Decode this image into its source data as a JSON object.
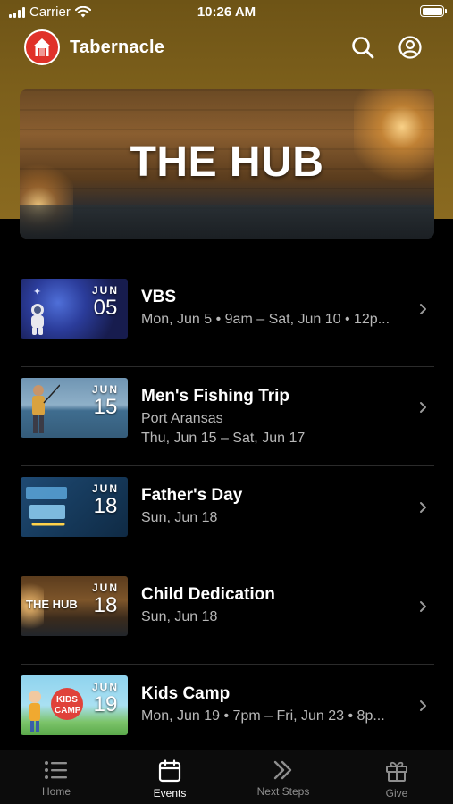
{
  "status_bar": {
    "carrier": "Carrier",
    "time": "10:26 AM"
  },
  "app": {
    "title": "Tabernacle"
  },
  "hero": {
    "title": "THE HUB"
  },
  "events": [
    {
      "title": "VBS",
      "lines": [
        "Mon, Jun 5 • 9am – Sat, Jun 10 • 12p..."
      ],
      "month": "JUN",
      "day": "05"
    },
    {
      "title": "Men's Fishing Trip",
      "lines": [
        "Port Aransas",
        "Thu, Jun 15 – Sat, Jun 17"
      ],
      "month": "JUN",
      "day": "15"
    },
    {
      "title": "Father's Day",
      "lines": [
        "Sun, Jun 18"
      ],
      "month": "JUN",
      "day": "18"
    },
    {
      "title": "Child Dedication",
      "lines": [
        "Sun, Jun 18"
      ],
      "month": "JUN",
      "day": "18",
      "thumb_text": "THE HUB"
    },
    {
      "title": "Kids Camp",
      "lines": [
        "Mon, Jun 19 • 7pm – Fri, Jun 23 • 8p..."
      ],
      "month": "JUN",
      "day": "19"
    }
  ],
  "tabs": [
    {
      "label": "Home",
      "icon": "list-icon"
    },
    {
      "label": "Events",
      "icon": "calendar-icon",
      "active": true
    },
    {
      "label": "Next Steps",
      "icon": "double-chevron-icon"
    },
    {
      "label": "Give",
      "icon": "gift-icon"
    }
  ],
  "colors": {
    "header_brown": "#7c5f1b",
    "logo_red": "#e0322a",
    "background": "#000000",
    "inactive_tab": "#8e8e8e"
  }
}
